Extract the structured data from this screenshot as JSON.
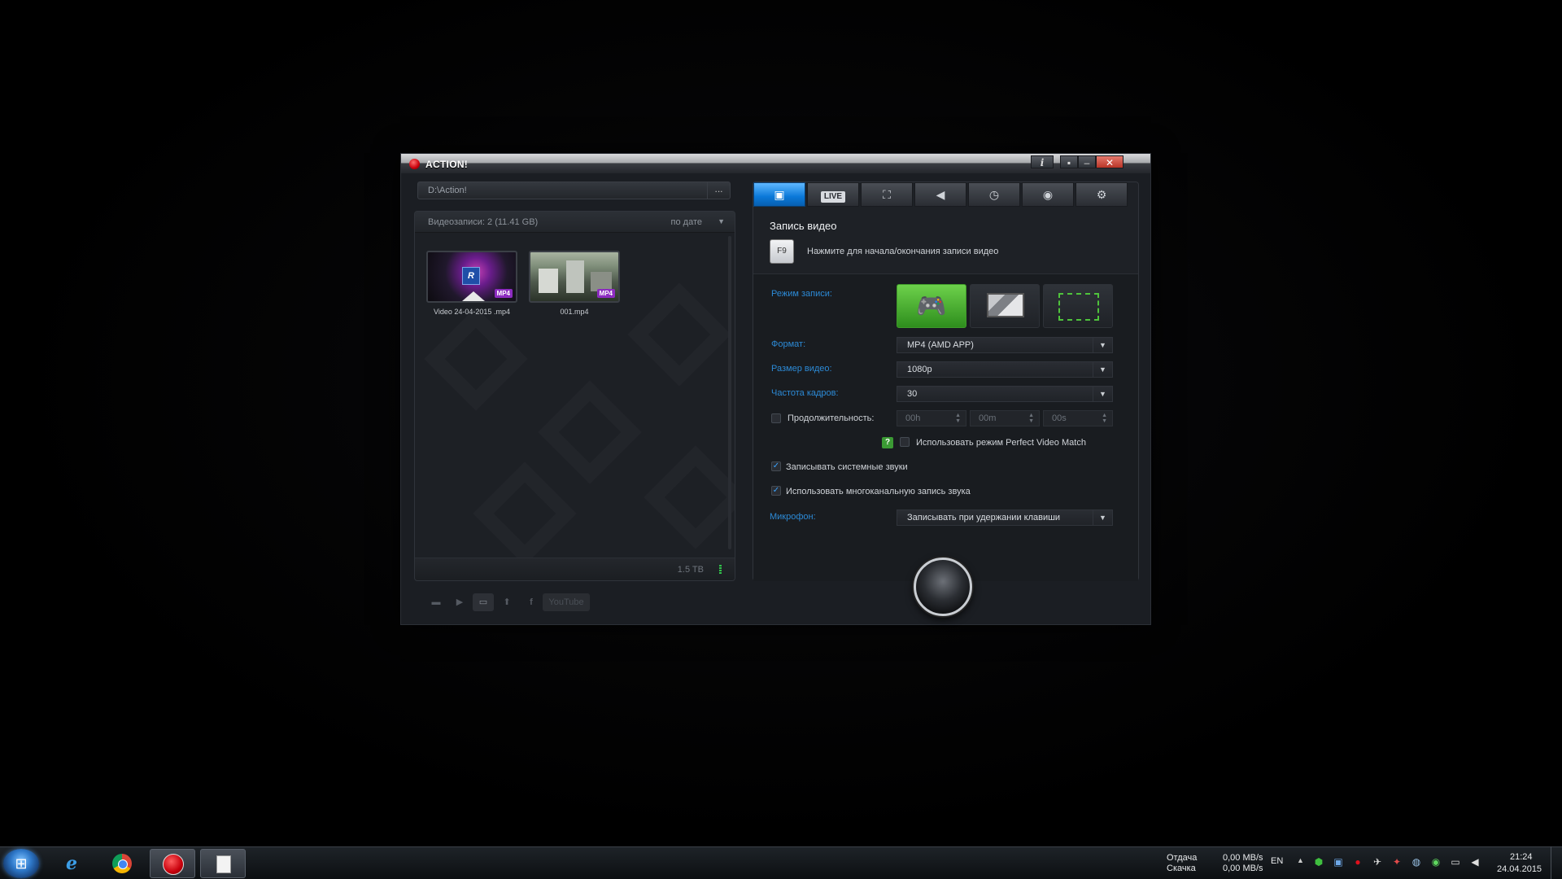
{
  "window": {
    "title": "ACTION!",
    "controls": {
      "info": "i",
      "pin": "▪",
      "minimize": "–",
      "close": "✕"
    }
  },
  "library": {
    "path": "D:\\Action!",
    "path_browse": "...",
    "count_label": "Видеозаписи: 2 (11.41 GB)",
    "sort_label": "по дате",
    "items": [
      {
        "filename": "Video 24-04-2015 .mp4",
        "badge": "MP4"
      },
      {
        "filename": "001.mp4",
        "badge": "MP4"
      }
    ],
    "free_space": "1.5 TB",
    "tools": {
      "youtube": "YouTube",
      "facebook": "f"
    }
  },
  "tabs": [
    {
      "name": "video-tab",
      "icon": "film-icon",
      "glyph": "▣"
    },
    {
      "name": "live-tab",
      "label": "LIVE"
    },
    {
      "name": "benchmark-tab",
      "icon": "chair-icon",
      "glyph": "⛶"
    },
    {
      "name": "audio-tab",
      "icon": "speaker-icon",
      "glyph": "◀"
    },
    {
      "name": "timer-tab",
      "icon": "stopwatch-icon",
      "glyph": "◷"
    },
    {
      "name": "screenshot-tab",
      "icon": "camera-icon",
      "glyph": "◉"
    },
    {
      "name": "settings-tab",
      "icon": "gear-icon",
      "glyph": "⚙"
    }
  ],
  "video": {
    "section_title": "Запись видео",
    "hotkey_key": "F9",
    "hotkey_text": "Нажмите для начала/окончания записи видео",
    "mode_label": "Режим записи:",
    "format_label": "Формат:",
    "format_value": "MP4 (AMD APP)",
    "size_label": "Размер видео:",
    "size_value": "1080p",
    "fps_label": "Частота кадров:",
    "fps_value": "30",
    "duration_label": "Продолжительность:",
    "duration_h": "00h",
    "duration_m": "00m",
    "duration_s": "00s",
    "duration_checked": false,
    "pvm_help": "?",
    "pvm_label": "Использовать режим Perfect Video Match",
    "pvm_checked": false,
    "system_sound_label": "Записывать системные звуки",
    "system_sound_checked": true,
    "multichannel_label": "Использовать многоканальную запись звука",
    "multichannel_checked": true,
    "mic_label": "Микрофон:",
    "mic_value": "Записывать при удержании клавиши"
  },
  "taskbar": {
    "net_up_label": "Отдача",
    "net_down_label": "Скачка",
    "net_up_value": "0,00 MB/s",
    "net_down_value": "0,00 MB/s",
    "language": "EN",
    "time": "21:24",
    "date": "24.04.2015"
  },
  "colors": {
    "accent_blue": "#0a78d8",
    "label_blue": "#2c8ad6",
    "game_mode_green": "#2e8e1d",
    "record_red": "#c8000c"
  }
}
